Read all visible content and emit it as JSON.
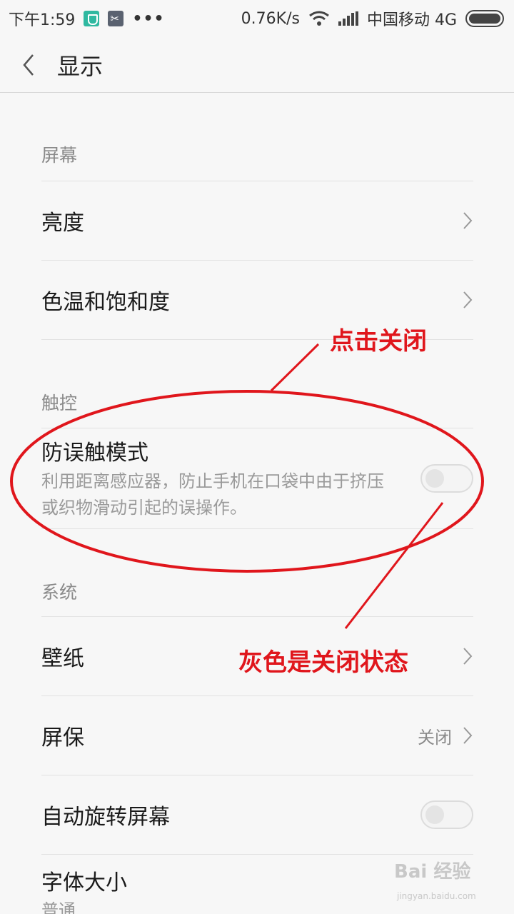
{
  "status_bar": {
    "time": "下午1:59",
    "dots": "•••",
    "speed": "0.76K/s",
    "carrier": "中国移动 4G"
  },
  "header": {
    "title": "显示"
  },
  "sections": {
    "screen": {
      "title": "屏幕",
      "brightness": "亮度",
      "color_temp": "色温和饱和度"
    },
    "touch": {
      "title": "触控",
      "anti_touch": "防误触模式",
      "anti_touch_desc": "利用距离感应器，防止手机在口袋中由于挤压或织物滑动引起的误操作。",
      "anti_touch_enabled": false
    },
    "system": {
      "title": "系统",
      "wallpaper": "壁纸",
      "screensaver": "屏保",
      "screensaver_value": "关闭",
      "auto_rotate": "自动旋转屏幕",
      "auto_rotate_enabled": false,
      "font_size": "字体大小",
      "font_size_value": "普通"
    }
  },
  "annotations": {
    "tap_to_close": "点击关闭",
    "gray_is_off": "灰色是关闭状态",
    "color": "#e0161c"
  },
  "watermark": {
    "brand": "Bai 经验",
    "url": "jingyan.baidu.com"
  }
}
